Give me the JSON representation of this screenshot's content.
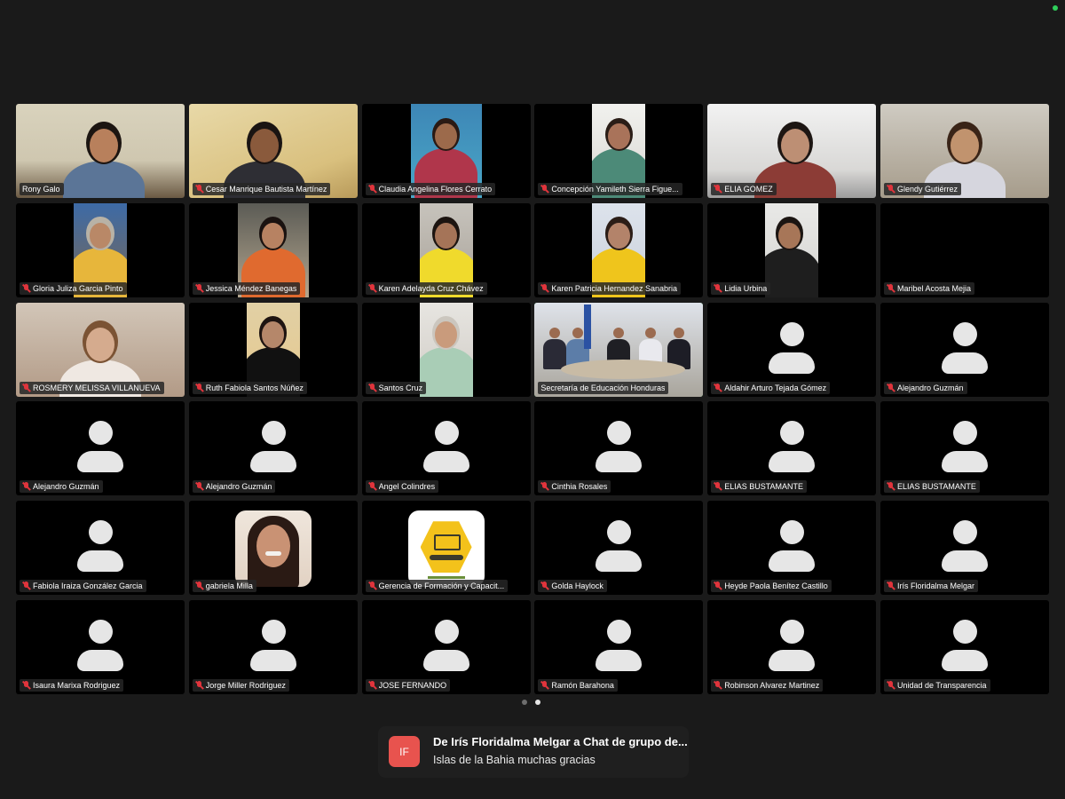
{
  "colors": {
    "background": "#1a1a1a",
    "tile": "#000000",
    "active_speaker_border": "#31c15a",
    "muted_icon": "#e0343c",
    "toast_avatar": "#e8534e"
  },
  "participants": [
    {
      "name": "Rony Galo",
      "muted": false,
      "video": "on"
    },
    {
      "name": "Cesar Manrique Bautista Martínez",
      "muted": true,
      "video": "on"
    },
    {
      "name": "Claudia Angelina Flores Cerrato",
      "muted": true,
      "video": "on"
    },
    {
      "name": "Concepción Yamileth Sierra Figue...",
      "muted": true,
      "video": "on"
    },
    {
      "name": "ELIA GOMEZ",
      "muted": true,
      "video": "on"
    },
    {
      "name": "Glendy Gutiérrez",
      "muted": true,
      "video": "on"
    },
    {
      "name": "Gloria Julizа Garcia Pinto",
      "muted": true,
      "video": "on"
    },
    {
      "name": "Jessica Méndez Banegas",
      "muted": true,
      "video": "on"
    },
    {
      "name": "Karen Adelayda Cruz Chávez",
      "muted": true,
      "video": "on"
    },
    {
      "name": "Karen Patricia Hernandez Sanabria",
      "muted": true,
      "video": "on"
    },
    {
      "name": "Lidia Urbina",
      "muted": true,
      "video": "on"
    },
    {
      "name": "Maribel Acosta Mejia",
      "muted": true,
      "video": "black"
    },
    {
      "name": "ROSMERY MELISSA VILLANUEVA",
      "muted": true,
      "video": "on"
    },
    {
      "name": "Ruth Fabiola Santos Núñez",
      "muted": true,
      "video": "on"
    },
    {
      "name": "Santos Cruz",
      "muted": true,
      "video": "on"
    },
    {
      "name": "Secretaría de Educación Honduras",
      "muted": false,
      "video": "on",
      "active_speaker": true
    },
    {
      "name": "Aldahir Arturo Tejada Gómez",
      "muted": true,
      "video": "off"
    },
    {
      "name": "Alejandro Guzmán",
      "muted": true,
      "video": "off"
    },
    {
      "name": "Alejandro Guzmán",
      "muted": true,
      "video": "off"
    },
    {
      "name": "Alejandro Guzmán",
      "muted": true,
      "video": "off"
    },
    {
      "name": "Angel Colindres",
      "muted": true,
      "video": "off"
    },
    {
      "name": "Cinthia Rosales",
      "muted": true,
      "video": "off"
    },
    {
      "name": "ELIAS BUSTAMANTE",
      "muted": true,
      "video": "off"
    },
    {
      "name": "ELIAS BUSTAMANTE",
      "muted": true,
      "video": "off"
    },
    {
      "name": "Fabiola Iraiza González Garcia",
      "muted": true,
      "video": "off"
    },
    {
      "name": "gabriela Milla",
      "muted": true,
      "video": "off",
      "avatar": "profile-photo"
    },
    {
      "name": "Gerencia de Formación y Capacit...",
      "muted": true,
      "video": "off",
      "avatar": "logo"
    },
    {
      "name": "Golda Haylock",
      "muted": true,
      "video": "off"
    },
    {
      "name": "Heyde Paola Benítez Castillo",
      "muted": true,
      "video": "off"
    },
    {
      "name": "Irís Floridalma Melgar",
      "muted": true,
      "video": "off"
    },
    {
      "name": "Isaura Marixa Rodriguez",
      "muted": true,
      "video": "off"
    },
    {
      "name": "Jorge Miller Rodriguez",
      "muted": true,
      "video": "off"
    },
    {
      "name": "JOSE FERNANDO",
      "muted": true,
      "video": "off"
    },
    {
      "name": "Ramón Barahona",
      "muted": true,
      "video": "off"
    },
    {
      "name": "Robinson Alvarez Martinez",
      "muted": true,
      "video": "off"
    },
    {
      "name": "Unidad de Transparencia",
      "muted": true,
      "video": "off"
    }
  ],
  "pager": {
    "pages": 2,
    "current": 2
  },
  "toast": {
    "initials": "IF",
    "title": "De Irís Floridalma Melgar a Chat de grupo de...",
    "message": "Islas de la Bahia muchas gracias"
  }
}
